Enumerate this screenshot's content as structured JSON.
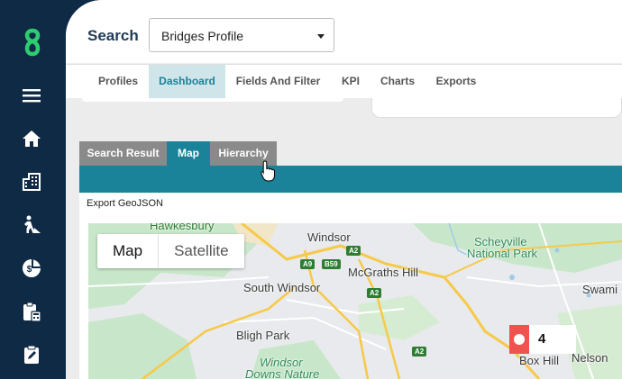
{
  "sidebar": {
    "items": [
      {
        "icon": "app-logo-icon"
      },
      {
        "icon": "menu-icon"
      },
      {
        "icon": "home-icon"
      },
      {
        "icon": "buildings-icon"
      },
      {
        "icon": "worker-icon"
      },
      {
        "icon": "finance-icon"
      },
      {
        "icon": "clipboard-calc-icon"
      },
      {
        "icon": "clipboard-edit-icon"
      }
    ]
  },
  "header": {
    "search_label": "Search",
    "profile_select": "Bridges Profile"
  },
  "tabs": [
    "Profiles",
    "Dashboard",
    "Fields And Filter",
    "KPI",
    "Charts",
    "Exports"
  ],
  "active_tab": "Dashboard",
  "subtabs": [
    "Search Result",
    "Map",
    "Hierarchy"
  ],
  "active_subtab": "Map",
  "map": {
    "export_label": "Export GeoJSON",
    "type_buttons": [
      "Map",
      "Satellite"
    ],
    "active_type": "Map",
    "places": [
      "Hawkesbury",
      "Windsor",
      "McGraths Hill",
      "Scheyville",
      "National Park",
      "South Windsor",
      "Swami",
      "Bligh Park",
      "Windsor",
      "Downs Nature",
      "Box Hill",
      "Nelson"
    ],
    "road_shields": [
      "A2",
      "A9",
      "B59",
      "A2",
      "A2"
    ],
    "cluster_count": "4"
  },
  "colors": {
    "sidebar": "#0f2a44",
    "accent": "#1a8299",
    "logo": "#2ecc71",
    "marker": "#ef5350"
  }
}
